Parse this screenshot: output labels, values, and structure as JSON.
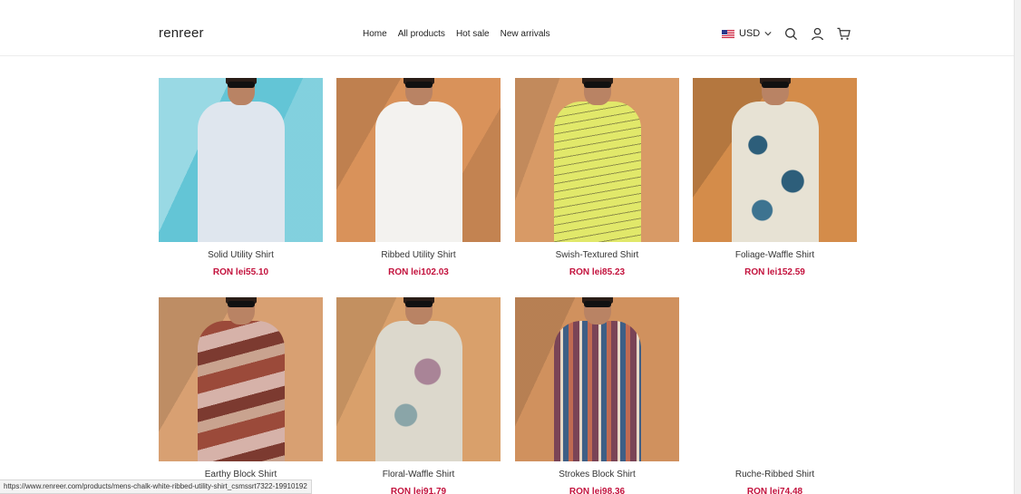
{
  "brand": "renreer",
  "nav": [
    "Home",
    "All products",
    "Hot sale",
    "New arrivals"
  ],
  "currency": {
    "code": "USD",
    "flag_icon": "us-flag-icon"
  },
  "header_icons": [
    "search-icon",
    "user-icon",
    "cart-icon"
  ],
  "colors": {
    "price": "#c3123d",
    "text": "#222222"
  },
  "products": [
    {
      "name": "Solid Utility Shirt",
      "price": "RON lei55.10",
      "bg": "#63c5d6",
      "shirt": "#dfe6ee",
      "shade": "#c8d2de"
    },
    {
      "name": "Ribbed Utility Shirt",
      "price": "RON lei102.03",
      "bg": "#d9925a",
      "shirt": "#f3f2ef",
      "shade": "#dcdad4"
    },
    {
      "name": "Swish-Textured Shirt",
      "price": "RON lei85.23",
      "bg": "#d89a66",
      "shirt": "#e1e86a",
      "shade": "#c9d04f"
    },
    {
      "name": "Foliage-Waffle Shirt",
      "price": "RON lei152.59",
      "bg": "#d48c4a",
      "shirt": "#2d5e7a",
      "shade": "#e7e2d4"
    },
    {
      "name": "Earthy Block Shirt",
      "price": "",
      "bg": "#d8a072",
      "shirt": "#9b4a3a",
      "shade": "#d6b2a9"
    },
    {
      "name": "Floral-Waffle Shirt",
      "price": "RON lei91.79",
      "bg": "#d9a06b",
      "shirt": "#dcd8cc",
      "shade": "#a98497"
    },
    {
      "name": "Strokes Block Shirt",
      "price": "RON lei98.36",
      "bg": "#d0915e",
      "shirt": "#7a4456",
      "shade": "#3e5f86"
    },
    {
      "name": "Ruche-Ribbed Shirt",
      "price": "RON lei74.48"
    }
  ],
  "status_url": "https://www.renreer.com/products/mens-chalk-white-ribbed-utility-shirt_csmssrt7322-19910192"
}
